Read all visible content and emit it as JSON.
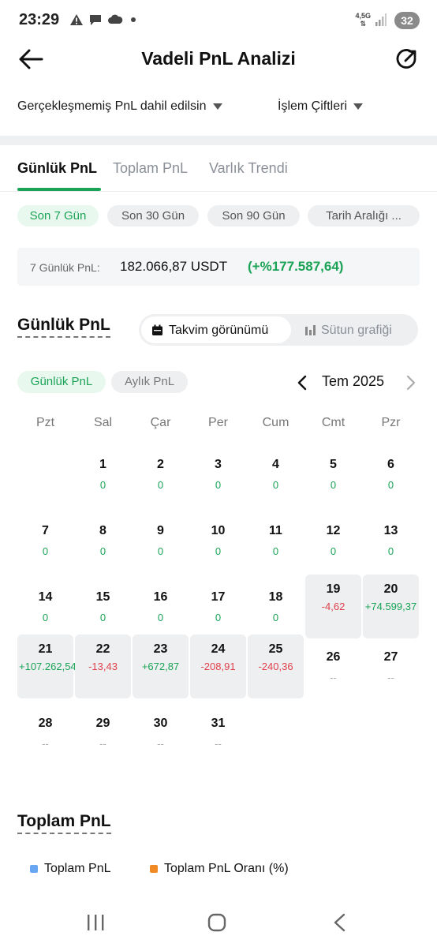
{
  "status_bar": {
    "time": "23:29",
    "network": "4,5G",
    "battery": "32",
    "icons": [
      "warning-icon",
      "chat-icon",
      "cloud-icon",
      "dot-icon",
      "signal-icon"
    ]
  },
  "header": {
    "title": "Vadeli PnL Analizi"
  },
  "filters": {
    "unrealized": "Gerçekleşmemiş PnL dahil edilsin",
    "pairs": "İşlem Çiftleri"
  },
  "tabs": [
    {
      "label": "Günlük PnL",
      "active": true
    },
    {
      "label": "Toplam PnL",
      "active": false
    },
    {
      "label": "Varlık Trendi",
      "active": false
    }
  ],
  "ranges": [
    {
      "label": "Son 7 Gün",
      "active": true
    },
    {
      "label": "Son 30 Gün",
      "active": false
    },
    {
      "label": "Son 90 Gün",
      "active": false
    },
    {
      "label": "Tarih Aralığı ...",
      "active": false
    }
  ],
  "summary": {
    "label": "7 Günlük PnL:",
    "value": "182.066,87 USDT",
    "change": "(+%177.587,64)"
  },
  "daily_section": {
    "title": "Günlük PnL",
    "calendar_view": "Takvim görünümü",
    "bar_view": "Sütun grafiği"
  },
  "modes": {
    "daily": "Günlük PnL",
    "monthly": "Aylık PnL"
  },
  "calendar": {
    "month": "Tem 2025",
    "weekdays": [
      "Pzt",
      "Sal",
      "Çar",
      "Per",
      "Cum",
      "Cmt",
      "Pzr"
    ],
    "days": [
      {
        "day": "1",
        "value": "0",
        "tone": "pos"
      },
      {
        "day": "2",
        "value": "0",
        "tone": "pos"
      },
      {
        "day": "3",
        "value": "0",
        "tone": "pos"
      },
      {
        "day": "4",
        "value": "0",
        "tone": "pos"
      },
      {
        "day": "5",
        "value": "0",
        "tone": "pos"
      },
      {
        "day": "6",
        "value": "0",
        "tone": "pos"
      },
      {
        "day": "7",
        "value": "0",
        "tone": "pos"
      },
      {
        "day": "8",
        "value": "0",
        "tone": "pos"
      },
      {
        "day": "9",
        "value": "0",
        "tone": "pos"
      },
      {
        "day": "10",
        "value": "0",
        "tone": "pos"
      },
      {
        "day": "11",
        "value": "0",
        "tone": "pos"
      },
      {
        "day": "12",
        "value": "0",
        "tone": "pos"
      },
      {
        "day": "13",
        "value": "0",
        "tone": "pos"
      },
      {
        "day": "14",
        "value": "0",
        "tone": "pos"
      },
      {
        "day": "15",
        "value": "0",
        "tone": "pos"
      },
      {
        "day": "16",
        "value": "0",
        "tone": "pos"
      },
      {
        "day": "17",
        "value": "0",
        "tone": "pos"
      },
      {
        "day": "18",
        "value": "0",
        "tone": "pos"
      },
      {
        "day": "19",
        "value": "-4,62",
        "tone": "neg",
        "highlighted": true
      },
      {
        "day": "20",
        "value": "+74.599,37",
        "tone": "pos",
        "highlighted": true
      },
      {
        "day": "21",
        "value": "+107.262,54",
        "tone": "pos",
        "highlighted": true
      },
      {
        "day": "22",
        "value": "-13,43",
        "tone": "neg",
        "highlighted": true
      },
      {
        "day": "23",
        "value": "+672,87",
        "tone": "pos",
        "highlighted": true
      },
      {
        "day": "24",
        "value": "-208,91",
        "tone": "neg",
        "highlighted": true
      },
      {
        "day": "25",
        "value": "-240,36",
        "tone": "neg",
        "highlighted": true
      },
      {
        "day": "26",
        "value": "--",
        "tone": "none"
      },
      {
        "day": "27",
        "value": "--",
        "tone": "none"
      },
      {
        "day": "28",
        "value": "--",
        "tone": "none"
      },
      {
        "day": "29",
        "value": "--",
        "tone": "none"
      },
      {
        "day": "30",
        "value": "--",
        "tone": "none"
      },
      {
        "day": "31",
        "value": "--",
        "tone": "none"
      }
    ]
  },
  "total_section": {
    "title": "Toplam PnL",
    "legend": [
      {
        "label": "Toplam PnL",
        "color": "#6aa7f2"
      },
      {
        "label": "Toplam PnL Oranı (%)",
        "color": "#f08a24"
      }
    ]
  },
  "colors": {
    "accent": "#1aa356",
    "negative": "#e0404a"
  },
  "navbar": {
    "icons": [
      "recents-icon",
      "home-icon",
      "back-nav-icon"
    ]
  }
}
